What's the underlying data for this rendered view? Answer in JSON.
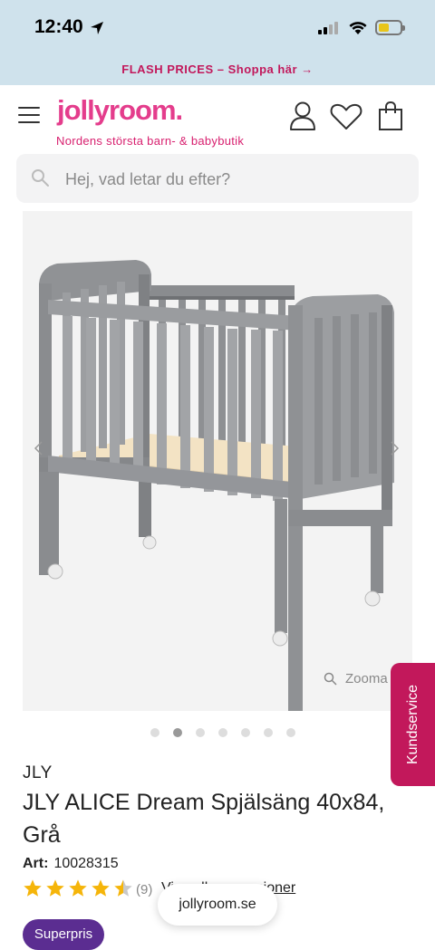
{
  "status_bar": {
    "time": "12:40"
  },
  "promo": {
    "text": "FLASH PRICES – Shoppa här →"
  },
  "header": {
    "logo": "jollyroom.",
    "tagline": "Nordens största barn- & babybutik"
  },
  "search": {
    "placeholder": "Hej, vad letar du efter?"
  },
  "gallery": {
    "zoom_label": "Zooma",
    "image_count": 7,
    "active_index": 1
  },
  "kundservice": {
    "label": "Kundservice"
  },
  "product": {
    "brand": "JLY",
    "title": "JLY ALICE Dream Spjälsäng 40x84, Grå",
    "art_label": "Art:",
    "art_number": "10028315",
    "rating": 4.5,
    "review_count": "(9)",
    "all_reviews_link": "Visa alla recensioner",
    "badge": "Superpris"
  },
  "browser": {
    "url": "jollyroom.se"
  },
  "colors": {
    "brand_pink": "#e43d8c",
    "promo_bg": "#cfe2ec",
    "kundservice_bg": "#c2185b",
    "star_color": "#f5b50a",
    "superpris_bg": "#5b2d91"
  }
}
